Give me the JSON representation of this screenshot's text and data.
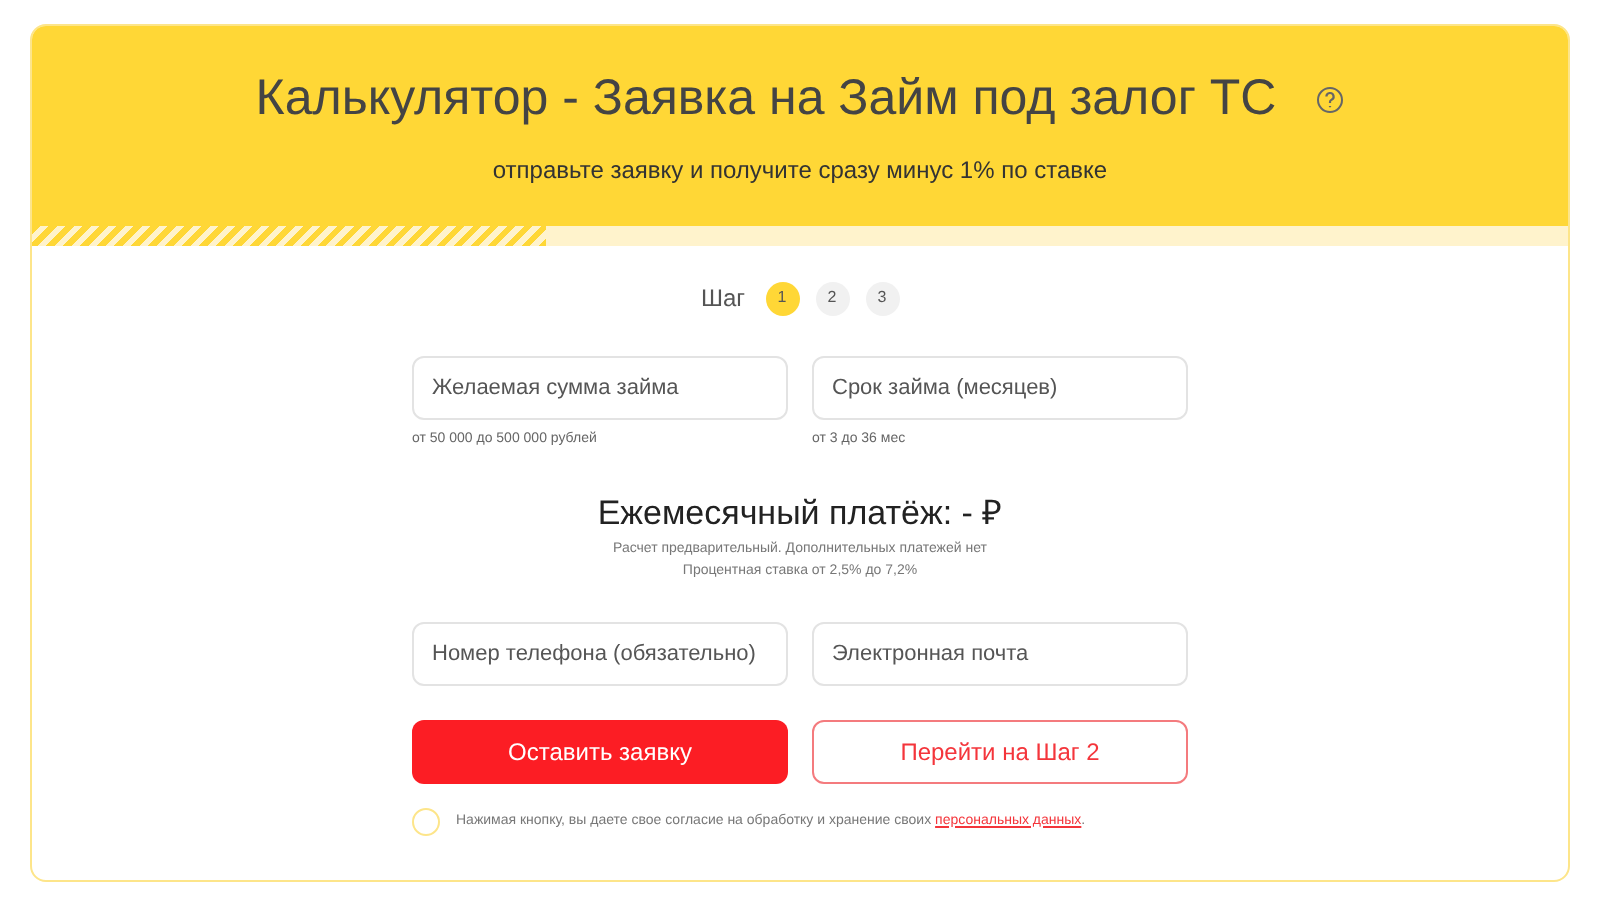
{
  "header": {
    "title": "Калькулятор - Заявка на Займ под залог ТС",
    "subtitle": "отправьте заявку и получите сразу минус 1% по ставке"
  },
  "progress": {
    "level": 0.335
  },
  "steps": {
    "label": "Шаг",
    "items": [
      {
        "label": "1",
        "selected": true
      },
      {
        "label": "2",
        "selected": false
      },
      {
        "label": "3",
        "selected": false
      }
    ]
  },
  "loan_fields": [
    {
      "placeholder": "Желаемая сумма займа",
      "hint": "от 50 000 до 500 000 рублей"
    },
    {
      "placeholder": "Срок займа (месяцев)",
      "hint": "от 3 до 36 мес"
    }
  ],
  "payment": {
    "title": "Ежемесячный платёж: - ₽",
    "notes": [
      "Расчет предварительный. Дополнительных платежей нет",
      "Процентная ставка от 2,5% до 7,2%"
    ]
  },
  "contact_fields": [
    {
      "placeholder": "Номер телефона (обязательно)"
    },
    {
      "placeholder": "Электронная почта"
    }
  ],
  "buttons": [
    {
      "label": "Оставить заявку",
      "kind": "primary"
    },
    {
      "label": "Перейти на Шаг 2",
      "kind": "outline"
    }
  ],
  "consent": {
    "checked": false,
    "text": "Нажимая кнопку, вы даете свое согласие на обработку и хранение своих",
    "link": "персональных данных",
    "end": "."
  }
}
